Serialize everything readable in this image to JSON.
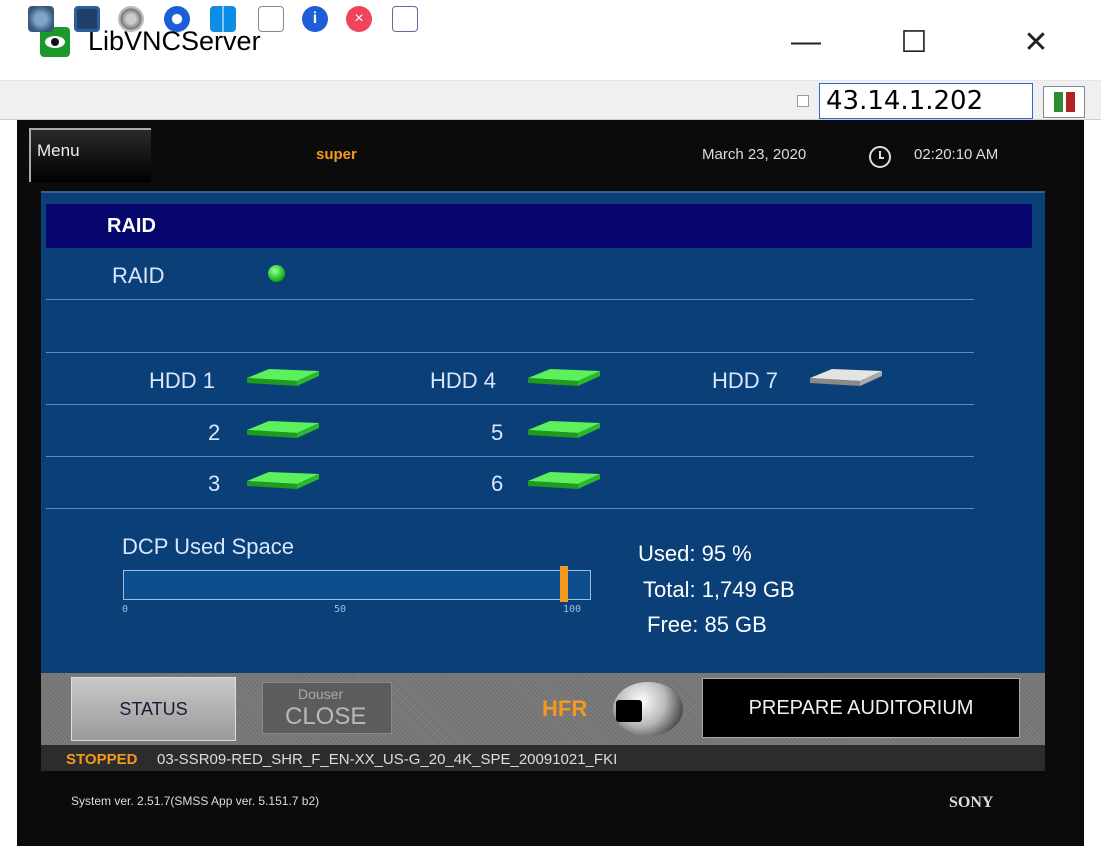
{
  "window": {
    "title": "LibVNCServer",
    "icon": "vnc-eye-icon",
    "controls": {
      "minimize": "—",
      "maximize": "☐",
      "close": "✕"
    }
  },
  "toolbar": {
    "icons": [
      "connection-icon",
      "fullscreen-icon",
      "settings-icon",
      "refresh-icon",
      "windows-key-icon",
      "keyboard-icon",
      "info-icon",
      "disconnect-icon",
      "file-transfer-icon"
    ],
    "server_address": "43.14.1.202"
  },
  "app": {
    "menu_label": "Menu",
    "user": "super",
    "date": "March 23, 2020",
    "time": "02:20:10 AM",
    "raid": {
      "header": "RAID",
      "status_label": "RAID",
      "status_color": "#1bbb1b",
      "drives": [
        {
          "label": "HDD 1",
          "status": "ok"
        },
        {
          "label": "2",
          "status": "ok"
        },
        {
          "label": "3",
          "status": "ok"
        },
        {
          "label": "HDD 4",
          "status": "ok"
        },
        {
          "label": "5",
          "status": "ok"
        },
        {
          "label": "6",
          "status": "ok"
        },
        {
          "label": "HDD 7",
          "status": "inactive"
        }
      ]
    },
    "usage": {
      "title": "DCP Used Space",
      "used_percent": 95,
      "used_text": "Used: 95 %",
      "total_text": "Total: 1,749 GB",
      "free_text": "Free: 85 GB",
      "scale": [
        "0",
        "50",
        "100"
      ]
    },
    "controls": {
      "status_label": "STATUS",
      "douser_label": "Douser",
      "douser_state": "CLOSE",
      "hfr_label": "HFR",
      "prepare_label": "PREPARE AUDITORIUM"
    },
    "playback": {
      "state": "STOPPED",
      "title": "03-SSR09-RED_SHR_F_EN-XX_US-G_20_4K_SPE_20091021_FKI"
    },
    "footer": {
      "version": "System ver. 2.51.7(SMSS App ver. 5.151.7 b2)",
      "brand": "SONY"
    }
  },
  "colors": {
    "panel": "#0a3f78",
    "header": "#06056b",
    "accent": "#f39a1c",
    "drive_ok": "#2ecc40",
    "drive_inactive": "#c8c8c8"
  }
}
